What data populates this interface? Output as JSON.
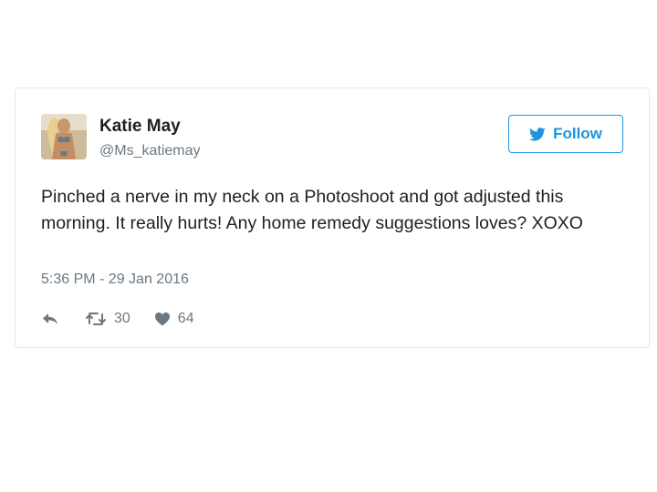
{
  "tweet": {
    "author": {
      "name": "Katie May",
      "handle": "@Ms_katiemay",
      "avatar_icon": "profile-photo"
    },
    "follow_button": {
      "label": "Follow",
      "icon": "twitter-bird-icon",
      "color": "#1b95e0"
    },
    "text": "Pinched a nerve in my neck on a Photoshoot and got adjusted this morning. It really hurts! Any home remedy suggestions loves? XOXO",
    "timestamp": "5:36 PM - 29 Jan 2016",
    "actions": {
      "reply_icon": "reply-icon",
      "retweet_icon": "retweet-icon",
      "retweet_count": "30",
      "like_icon": "heart-icon",
      "like_count": "64"
    }
  }
}
